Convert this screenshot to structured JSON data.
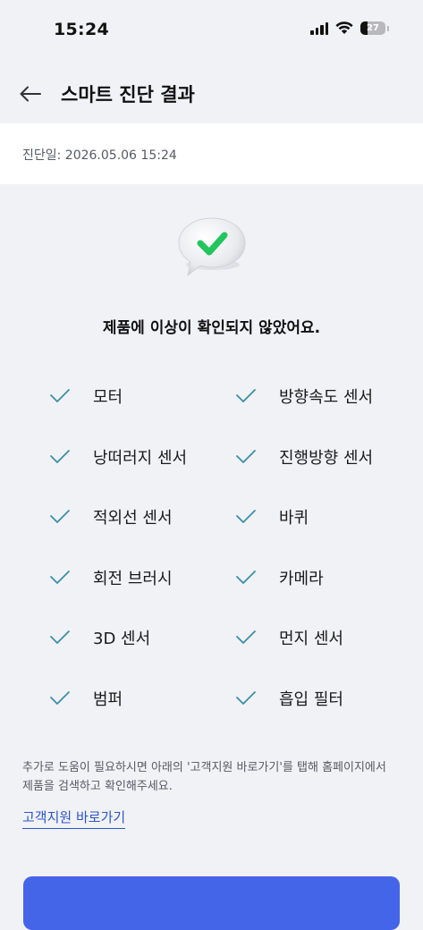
{
  "status_bar": {
    "time": "15:24",
    "battery": "27",
    "battery_level": 0.27
  },
  "header": {
    "title": "스마트 진단 결과",
    "back_icon": "arrow-left-icon"
  },
  "diagnosis": {
    "date_text": "진단일: 2026.05.06 15:24",
    "result_icon": "speech-bubble-check-icon",
    "message": "제품에 이상이 확인되지 않았어요."
  },
  "checks": [
    {
      "label": "모터"
    },
    {
      "label": "방향속도 센서"
    },
    {
      "label": "낭떠러지 센서"
    },
    {
      "label": "진행방향 센서"
    },
    {
      "label": "적외선 센서"
    },
    {
      "label": "바퀴"
    },
    {
      "label": "회전 브러시"
    },
    {
      "label": "카메라"
    },
    {
      "label": "3D 센서"
    },
    {
      "label": "먼지 센서"
    },
    {
      "label": "범퍼"
    },
    {
      "label": "흡입 필터"
    }
  ],
  "help": {
    "text": "추가로 도움이 필요하시면 아래의 '고객지원 바로가기'를 탭해 홈페이지에서 제품을 검색하고 확인해주세요.",
    "link_label": "고객지원 바로가기"
  },
  "colors": {
    "check": "#3b8fa6",
    "accent": "#4565e8",
    "link": "#2e54c9",
    "success": "#22c55e"
  }
}
